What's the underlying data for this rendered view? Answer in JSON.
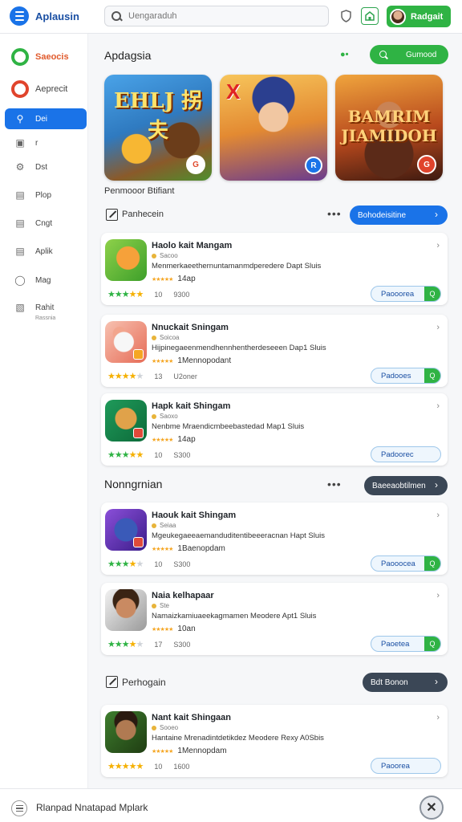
{
  "header": {
    "app_name": "Aplausin",
    "search_placeholder": "Uengaraduh",
    "shield_icon": "shield-icon",
    "store_icon": "store-icon",
    "user_name": "Radgait",
    "brand_color": "#1a73e8",
    "accent_green": "#2fb344"
  },
  "sidebar": {
    "top_items": [
      {
        "label": "Saeocis",
        "color": "#e05a2c",
        "ring": "#2fb344"
      },
      {
        "label": "Aeprecit",
        "color": "#444444",
        "ring": "#e0442c"
      }
    ],
    "items": [
      {
        "label": "Dei",
        "icon": "tag-icon",
        "active": true
      },
      {
        "label": "r",
        "icon": "image-icon",
        "active": false
      },
      {
        "label": "Dst",
        "icon": "gear-icon",
        "active": false
      },
      {
        "label": "Plop",
        "icon": "file-icon",
        "active": false
      },
      {
        "label": "Cngt",
        "icon": "doc-icon",
        "active": false
      },
      {
        "label": "Aplik",
        "icon": "doc-icon",
        "active": false
      },
      {
        "label": "Mag",
        "icon": "info-icon",
        "active": false
      },
      {
        "label": "Rahit",
        "icon": "chart-icon",
        "active": false,
        "sub": "Rassnia"
      }
    ]
  },
  "featured": {
    "title": "Apdagsia",
    "search_button": "Gumood",
    "caption": "Penmooor Btifiant",
    "banners": [
      {
        "title": "EHLJ 拐夫",
        "badge": "G"
      },
      {
        "title": "",
        "badge": "R"
      },
      {
        "title": "BAMRIM JIAMIDOH",
        "badge": "G"
      }
    ]
  },
  "sections": [
    {
      "label": "Panhecein",
      "button": "Bohodeisitine",
      "apps": [
        {
          "title": "Haolo kait Mangam",
          "dev": "Sacoo",
          "desc": "Menmerkaeethernuntamanmdperedere Dapt Sluis",
          "mini_value": "14ap",
          "stars": [
            1,
            1,
            1,
            1,
            0.5
          ],
          "count": "10",
          "size": "9300",
          "install": "Paooorea",
          "install_tail": "Q"
        },
        {
          "title": "Nnuckait Sningam",
          "dev": "Soicoa",
          "desc": "Hijpinegaeenmendhennhentherdeseeen Dap1 Sluis",
          "mini_value": "1Mennopodant",
          "stars": [
            1,
            1,
            1,
            1,
            0
          ],
          "count": "13",
          "size": "U2oner",
          "install": "Padooes",
          "install_tail": "Q"
        },
        {
          "title": "Hapk kait Shingam",
          "dev": "Saoxo",
          "desc": "Nenbme Mraendicmbeebastedad Map1 Sluis",
          "mini_value": "14ap",
          "stars": [
            1,
            1,
            1,
            1,
            0.5
          ],
          "count": "10",
          "size": "S300",
          "install": "Padoorec",
          "install_tail": ""
        }
      ]
    },
    {
      "label": "Nonngrnian",
      "button": "Baeeaobtilmen",
      "apps": [
        {
          "title": "Haouk kait Shingam",
          "dev": "Seiaa",
          "desc": "Mgeukegaeeaemanduditentibeeeracnan Hapt Sluis",
          "mini_value": "1Baenopdam",
          "stars": [
            1,
            1,
            1,
            1,
            0.5
          ],
          "count": "10",
          "size": "S300",
          "install": "Paooocea",
          "install_tail": "Q"
        },
        {
          "title": "Naia kelhapaar",
          "dev": "Ste",
          "desc": "Namaizkamiuaeekagmamen Meodere Apt1 Sluis",
          "mini_value": "10an",
          "stars": [
            1,
            1,
            1,
            1,
            0.5
          ],
          "count": "17",
          "size": "S300",
          "install": "Paoetea",
          "install_tail": "Q"
        }
      ]
    },
    {
      "label": "Perhogain",
      "button": "Bdt Bonon",
      "apps": [
        {
          "title": "Nant kait Shingaan",
          "dev": "Sooeo",
          "desc": "Hantaine Mrenadintdetikdez Meodere Rexy A0Sbis",
          "mini_value": "1Mennopdam",
          "stars": [
            1,
            1,
            1,
            1,
            1
          ],
          "count": "10",
          "size": "1600",
          "install": "Paoorea",
          "install_tail": ""
        }
      ]
    }
  ],
  "bottom": {
    "text": "Rlanpad Nnatapad Mplark"
  }
}
